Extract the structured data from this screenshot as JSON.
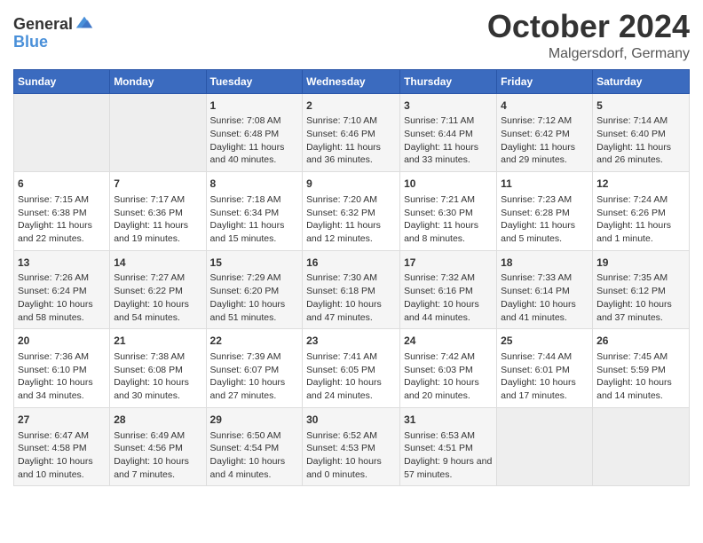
{
  "header": {
    "logo_general": "General",
    "logo_blue": "Blue",
    "month": "October 2024",
    "location": "Malgersdorf, Germany"
  },
  "calendar": {
    "days_of_week": [
      "Sunday",
      "Monday",
      "Tuesday",
      "Wednesday",
      "Thursday",
      "Friday",
      "Saturday"
    ],
    "weeks": [
      [
        {
          "day": null
        },
        {
          "day": null
        },
        {
          "day": "1",
          "sunrise": "Sunrise: 7:08 AM",
          "sunset": "Sunset: 6:48 PM",
          "daylight": "Daylight: 11 hours and 40 minutes."
        },
        {
          "day": "2",
          "sunrise": "Sunrise: 7:10 AM",
          "sunset": "Sunset: 6:46 PM",
          "daylight": "Daylight: 11 hours and 36 minutes."
        },
        {
          "day": "3",
          "sunrise": "Sunrise: 7:11 AM",
          "sunset": "Sunset: 6:44 PM",
          "daylight": "Daylight: 11 hours and 33 minutes."
        },
        {
          "day": "4",
          "sunrise": "Sunrise: 7:12 AM",
          "sunset": "Sunset: 6:42 PM",
          "daylight": "Daylight: 11 hours and 29 minutes."
        },
        {
          "day": "5",
          "sunrise": "Sunrise: 7:14 AM",
          "sunset": "Sunset: 6:40 PM",
          "daylight": "Daylight: 11 hours and 26 minutes."
        }
      ],
      [
        {
          "day": "6",
          "sunrise": "Sunrise: 7:15 AM",
          "sunset": "Sunset: 6:38 PM",
          "daylight": "Daylight: 11 hours and 22 minutes."
        },
        {
          "day": "7",
          "sunrise": "Sunrise: 7:17 AM",
          "sunset": "Sunset: 6:36 PM",
          "daylight": "Daylight: 11 hours and 19 minutes."
        },
        {
          "day": "8",
          "sunrise": "Sunrise: 7:18 AM",
          "sunset": "Sunset: 6:34 PM",
          "daylight": "Daylight: 11 hours and 15 minutes."
        },
        {
          "day": "9",
          "sunrise": "Sunrise: 7:20 AM",
          "sunset": "Sunset: 6:32 PM",
          "daylight": "Daylight: 11 hours and 12 minutes."
        },
        {
          "day": "10",
          "sunrise": "Sunrise: 7:21 AM",
          "sunset": "Sunset: 6:30 PM",
          "daylight": "Daylight: 11 hours and 8 minutes."
        },
        {
          "day": "11",
          "sunrise": "Sunrise: 7:23 AM",
          "sunset": "Sunset: 6:28 PM",
          "daylight": "Daylight: 11 hours and 5 minutes."
        },
        {
          "day": "12",
          "sunrise": "Sunrise: 7:24 AM",
          "sunset": "Sunset: 6:26 PM",
          "daylight": "Daylight: 11 hours and 1 minute."
        }
      ],
      [
        {
          "day": "13",
          "sunrise": "Sunrise: 7:26 AM",
          "sunset": "Sunset: 6:24 PM",
          "daylight": "Daylight: 10 hours and 58 minutes."
        },
        {
          "day": "14",
          "sunrise": "Sunrise: 7:27 AM",
          "sunset": "Sunset: 6:22 PM",
          "daylight": "Daylight: 10 hours and 54 minutes."
        },
        {
          "day": "15",
          "sunrise": "Sunrise: 7:29 AM",
          "sunset": "Sunset: 6:20 PM",
          "daylight": "Daylight: 10 hours and 51 minutes."
        },
        {
          "day": "16",
          "sunrise": "Sunrise: 7:30 AM",
          "sunset": "Sunset: 6:18 PM",
          "daylight": "Daylight: 10 hours and 47 minutes."
        },
        {
          "day": "17",
          "sunrise": "Sunrise: 7:32 AM",
          "sunset": "Sunset: 6:16 PM",
          "daylight": "Daylight: 10 hours and 44 minutes."
        },
        {
          "day": "18",
          "sunrise": "Sunrise: 7:33 AM",
          "sunset": "Sunset: 6:14 PM",
          "daylight": "Daylight: 10 hours and 41 minutes."
        },
        {
          "day": "19",
          "sunrise": "Sunrise: 7:35 AM",
          "sunset": "Sunset: 6:12 PM",
          "daylight": "Daylight: 10 hours and 37 minutes."
        }
      ],
      [
        {
          "day": "20",
          "sunrise": "Sunrise: 7:36 AM",
          "sunset": "Sunset: 6:10 PM",
          "daylight": "Daylight: 10 hours and 34 minutes."
        },
        {
          "day": "21",
          "sunrise": "Sunrise: 7:38 AM",
          "sunset": "Sunset: 6:08 PM",
          "daylight": "Daylight: 10 hours and 30 minutes."
        },
        {
          "day": "22",
          "sunrise": "Sunrise: 7:39 AM",
          "sunset": "Sunset: 6:07 PM",
          "daylight": "Daylight: 10 hours and 27 minutes."
        },
        {
          "day": "23",
          "sunrise": "Sunrise: 7:41 AM",
          "sunset": "Sunset: 6:05 PM",
          "daylight": "Daylight: 10 hours and 24 minutes."
        },
        {
          "day": "24",
          "sunrise": "Sunrise: 7:42 AM",
          "sunset": "Sunset: 6:03 PM",
          "daylight": "Daylight: 10 hours and 20 minutes."
        },
        {
          "day": "25",
          "sunrise": "Sunrise: 7:44 AM",
          "sunset": "Sunset: 6:01 PM",
          "daylight": "Daylight: 10 hours and 17 minutes."
        },
        {
          "day": "26",
          "sunrise": "Sunrise: 7:45 AM",
          "sunset": "Sunset: 5:59 PM",
          "daylight": "Daylight: 10 hours and 14 minutes."
        }
      ],
      [
        {
          "day": "27",
          "sunrise": "Sunrise: 6:47 AM",
          "sunset": "Sunset: 4:58 PM",
          "daylight": "Daylight: 10 hours and 10 minutes."
        },
        {
          "day": "28",
          "sunrise": "Sunrise: 6:49 AM",
          "sunset": "Sunset: 4:56 PM",
          "daylight": "Daylight: 10 hours and 7 minutes."
        },
        {
          "day": "29",
          "sunrise": "Sunrise: 6:50 AM",
          "sunset": "Sunset: 4:54 PM",
          "daylight": "Daylight: 10 hours and 4 minutes."
        },
        {
          "day": "30",
          "sunrise": "Sunrise: 6:52 AM",
          "sunset": "Sunset: 4:53 PM",
          "daylight": "Daylight: 10 hours and 0 minutes."
        },
        {
          "day": "31",
          "sunrise": "Sunrise: 6:53 AM",
          "sunset": "Sunset: 4:51 PM",
          "daylight": "Daylight: 9 hours and 57 minutes."
        },
        {
          "day": null
        },
        {
          "day": null
        }
      ]
    ]
  }
}
